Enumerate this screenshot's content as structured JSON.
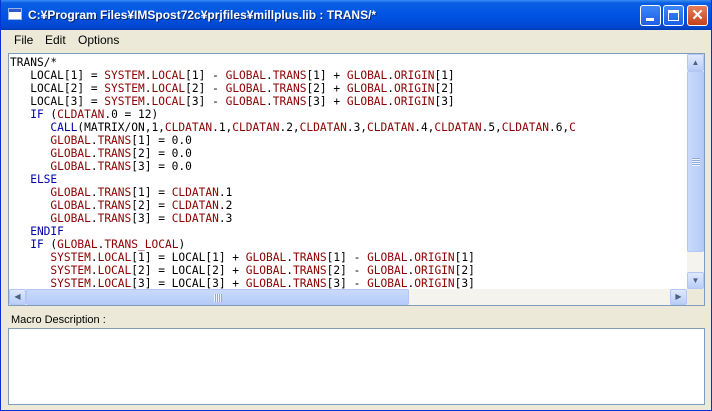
{
  "window": {
    "title": "C:¥Program Files¥IMSpost72c¥prjfiles¥millplus.lib  : TRANS/*",
    "close_glyph": "✕"
  },
  "menu": [
    {
      "label": "File"
    },
    {
      "label": "Edit"
    },
    {
      "label": "Options"
    }
  ],
  "colors": {
    "keyword": "#0000a8",
    "identifier": "#8b0000",
    "plain": "#000000"
  },
  "code_lines": [
    [
      [
        "b",
        "TRANS/*"
      ]
    ],
    [
      [
        "b",
        "   LOCAL[1] = "
      ],
      [
        "r",
        "SYSTEM"
      ],
      [
        "b",
        "."
      ],
      [
        "r",
        "LOCAL"
      ],
      [
        "b",
        "[1] - "
      ],
      [
        "r",
        "GLOBAL"
      ],
      [
        "b",
        "."
      ],
      [
        "r",
        "TRANS"
      ],
      [
        "b",
        "[1] + "
      ],
      [
        "r",
        "GLOBAL"
      ],
      [
        "b",
        "."
      ],
      [
        "r",
        "ORIGIN"
      ],
      [
        "b",
        "[1]"
      ]
    ],
    [
      [
        "b",
        "   LOCAL[2] = "
      ],
      [
        "r",
        "SYSTEM"
      ],
      [
        "b",
        "."
      ],
      [
        "r",
        "LOCAL"
      ],
      [
        "b",
        "[2] - "
      ],
      [
        "r",
        "GLOBAL"
      ],
      [
        "b",
        "."
      ],
      [
        "r",
        "TRANS"
      ],
      [
        "b",
        "[2] + "
      ],
      [
        "r",
        "GLOBAL"
      ],
      [
        "b",
        "."
      ],
      [
        "r",
        "ORIGIN"
      ],
      [
        "b",
        "[2]"
      ]
    ],
    [
      [
        "b",
        "   LOCAL[3] = "
      ],
      [
        "r",
        "SYSTEM"
      ],
      [
        "b",
        "."
      ],
      [
        "r",
        "LOCAL"
      ],
      [
        "b",
        "[3] - "
      ],
      [
        "r",
        "GLOBAL"
      ],
      [
        "b",
        "."
      ],
      [
        "r",
        "TRANS"
      ],
      [
        "b",
        "[3] + "
      ],
      [
        "r",
        "GLOBAL"
      ],
      [
        "b",
        "."
      ],
      [
        "r",
        "ORIGIN"
      ],
      [
        "b",
        "[3]"
      ]
    ],
    [
      [
        "k",
        "   IF "
      ],
      [
        "b",
        "("
      ],
      [
        "r",
        "CLDATAN"
      ],
      [
        "b",
        ".0 = 12)"
      ]
    ],
    [
      [
        "k",
        "      CALL"
      ],
      [
        "b",
        "(MATRIX/ON,1,"
      ],
      [
        "r",
        "CLDATAN"
      ],
      [
        "b",
        ".1,"
      ],
      [
        "r",
        "CLDATAN"
      ],
      [
        "b",
        ".2,"
      ],
      [
        "r",
        "CLDATAN"
      ],
      [
        "b",
        ".3,"
      ],
      [
        "r",
        "CLDATAN"
      ],
      [
        "b",
        ".4,"
      ],
      [
        "r",
        "CLDATAN"
      ],
      [
        "b",
        ".5,"
      ],
      [
        "r",
        "CLDATAN"
      ],
      [
        "b",
        ".6,"
      ],
      [
        "r",
        "C"
      ]
    ],
    [
      [
        "r",
        "      GLOBAL"
      ],
      [
        "b",
        "."
      ],
      [
        "r",
        "TRANS"
      ],
      [
        "b",
        "[1] = 0.0"
      ]
    ],
    [
      [
        "r",
        "      GLOBAL"
      ],
      [
        "b",
        "."
      ],
      [
        "r",
        "TRANS"
      ],
      [
        "b",
        "[2] = 0.0"
      ]
    ],
    [
      [
        "r",
        "      GLOBAL"
      ],
      [
        "b",
        "."
      ],
      [
        "r",
        "TRANS"
      ],
      [
        "b",
        "[3] = 0.0"
      ]
    ],
    [
      [
        "k",
        "   ELSE"
      ]
    ],
    [
      [
        "r",
        "      GLOBAL"
      ],
      [
        "b",
        "."
      ],
      [
        "r",
        "TRANS"
      ],
      [
        "b",
        "[1] = "
      ],
      [
        "r",
        "CLDATAN"
      ],
      [
        "b",
        ".1"
      ]
    ],
    [
      [
        "r",
        "      GLOBAL"
      ],
      [
        "b",
        "."
      ],
      [
        "r",
        "TRANS"
      ],
      [
        "b",
        "[2] = "
      ],
      [
        "r",
        "CLDATAN"
      ],
      [
        "b",
        ".2"
      ]
    ],
    [
      [
        "r",
        "      GLOBAL"
      ],
      [
        "b",
        "."
      ],
      [
        "r",
        "TRANS"
      ],
      [
        "b",
        "[3] = "
      ],
      [
        "r",
        "CLDATAN"
      ],
      [
        "b",
        ".3"
      ]
    ],
    [
      [
        "k",
        "   ENDIF"
      ]
    ],
    [
      [
        "k",
        "   IF "
      ],
      [
        "b",
        "("
      ],
      [
        "r",
        "GLOBAL"
      ],
      [
        "b",
        "."
      ],
      [
        "r",
        "TRANS_LOCAL"
      ],
      [
        "b",
        ")"
      ]
    ],
    [
      [
        "r",
        "      SYSTEM"
      ],
      [
        "b",
        "."
      ],
      [
        "r",
        "LOCAL"
      ],
      [
        "b",
        "[1] = LOCAL[1] + "
      ],
      [
        "r",
        "GLOBAL"
      ],
      [
        "b",
        "."
      ],
      [
        "r",
        "TRANS"
      ],
      [
        "b",
        "[1] - "
      ],
      [
        "r",
        "GLOBAL"
      ],
      [
        "b",
        "."
      ],
      [
        "r",
        "ORIGIN"
      ],
      [
        "b",
        "[1]"
      ]
    ],
    [
      [
        "r",
        "      SYSTEM"
      ],
      [
        "b",
        "."
      ],
      [
        "r",
        "LOCAL"
      ],
      [
        "b",
        "[2] = LOCAL[2] + "
      ],
      [
        "r",
        "GLOBAL"
      ],
      [
        "b",
        "."
      ],
      [
        "r",
        "TRANS"
      ],
      [
        "b",
        "[2] - "
      ],
      [
        "r",
        "GLOBAL"
      ],
      [
        "b",
        "."
      ],
      [
        "r",
        "ORIGIN"
      ],
      [
        "b",
        "[2]"
      ]
    ],
    [
      [
        "r",
        "      SYSTEM"
      ],
      [
        "b",
        "."
      ],
      [
        "r",
        "LOCAL"
      ],
      [
        "b",
        "[3] = LOCAL[3] + "
      ],
      [
        "r",
        "GLOBAL"
      ],
      [
        "b",
        "."
      ],
      [
        "r",
        "TRANS"
      ],
      [
        "b",
        "[3] - "
      ],
      [
        "r",
        "GLOBAL"
      ],
      [
        "b",
        "."
      ],
      [
        "r",
        "ORIGIN"
      ],
      [
        "b",
        "[3]"
      ]
    ]
  ],
  "scrollbars": {
    "up_arrow": "▲",
    "down_arrow": "▼",
    "left_arrow": "◀",
    "right_arrow": "▶"
  },
  "description": {
    "label": "Macro Description :",
    "value": ""
  }
}
